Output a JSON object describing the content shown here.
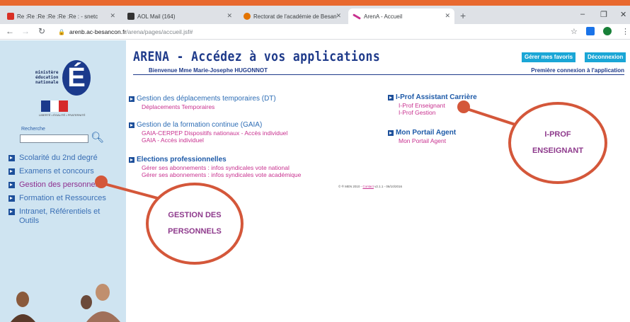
{
  "browser": {
    "tabs": [
      {
        "label": "Re :Re :Re :Re :Re :Re : - snetc",
        "favicon_color": "#d93025"
      },
      {
        "label": "AOL Mail (164)",
        "favicon_color": "#333333"
      },
      {
        "label": "Rectorat de l'académie de Besan",
        "favicon_color": "#e37400"
      },
      {
        "label": "ArenA - Accueil",
        "favicon_color": "#c8318f"
      }
    ],
    "new_tab": "+",
    "url_host": "arenb.ac-besancon.fr",
    "url_path": "/arena/pages/accueil.jsf#",
    "window_controls": [
      "–",
      "❐",
      "✕"
    ]
  },
  "sidebar": {
    "logo_text": "ministère\néducation\nnationale",
    "logo_letter": "É",
    "flag_colors": [
      "#1b3a8c",
      "#ffffff",
      "#d62b2b"
    ],
    "flag_caption": "LIBERTÉ • ÉGALITÉ • FRATERNITÉ",
    "search_label": "Recherche",
    "search_value": "",
    "nav_items": [
      {
        "label": "Scolarité du 2nd degré"
      },
      {
        "label": "Examens et concours"
      },
      {
        "label": "Gestion des personnels"
      },
      {
        "label": "Formation et Ressources"
      },
      {
        "label": "Intranet, Référentiels et Outils"
      }
    ]
  },
  "header": {
    "title": "ARENA - Accédez à vos applications",
    "btn_favoris": "Gérer mes favoris",
    "btn_deconnexion": "Déconnexion",
    "welcome": "Bienvenue Mme Marie-Josephe HUGONNOT",
    "first_connection": "Première connexion à l'application"
  },
  "sections": {
    "dt": {
      "title": "Gestion des déplacements temporaires (DT)",
      "links": [
        "Déplacements Temporaires"
      ]
    },
    "gaia": {
      "title": "Gestion de la formation continue (GAIA)",
      "links": [
        "GAIA-CERPEP Dispositifs nationaux - Accès individuel",
        "GAIA - Accès individuel"
      ]
    },
    "elections": {
      "title": "Elections professionnelles",
      "links": [
        "Gérer ses abonnements : infos syndicales vote national",
        "Gérer ses abonnements : infos syndicales vote académique"
      ]
    },
    "iprof": {
      "title": "I-Prof Assistant Carrière",
      "links": [
        "I-Prof Enseignant",
        "I-Prof Gestion"
      ]
    },
    "portail": {
      "title": "Mon Portail Agent",
      "links": [
        "Mon Portail Agent"
      ]
    }
  },
  "footer": {
    "prefix": "© ® MEN 2010 - ",
    "contact": "Contact",
    "suffix": " v2.1.1 - 06/10/2016"
  },
  "annotations": {
    "iprof_line1": "I-PROF",
    "iprof_line2": "ENSEIGNANT",
    "gestion_line1": "GESTION DES",
    "gestion_line2": "PERSONNELS"
  },
  "colors": {
    "frame": "#e8692f",
    "annotation": "#d4573a",
    "annotation_text": "#8e3a8c",
    "link": "#c8318f",
    "heading": "#1e3a8a",
    "sidebar": "#cfe4f1"
  }
}
